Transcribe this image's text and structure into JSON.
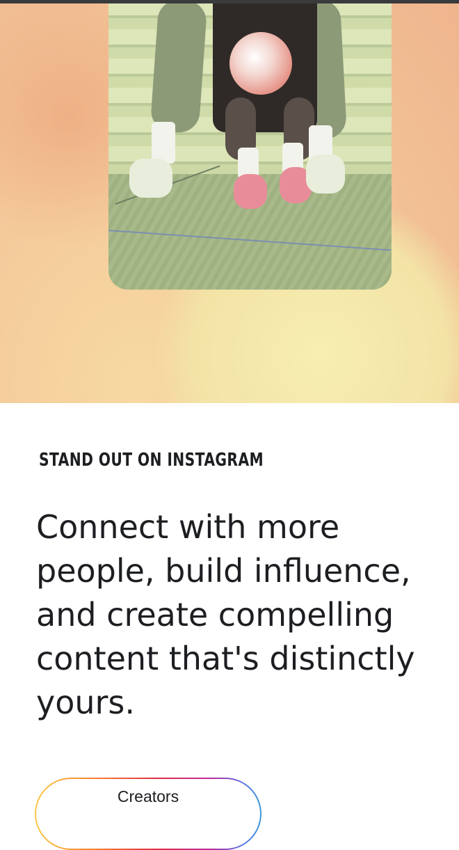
{
  "hero": {
    "image_alt": "Video of a person juggling a soccer ball on stairs",
    "background_colors": [
      "#f4c89a",
      "#f7eeb0",
      "#efb58e"
    ]
  },
  "section": {
    "eyebrow": "STAND OUT ON INSTAGRAM",
    "headline": "Connect with more people, build influence, and create compelling content that's distinctly yours."
  },
  "cta": {
    "label": "Creators",
    "gradient_colors": [
      "#fcc944",
      "#f57c2e",
      "#e12a48",
      "#bb2a9c",
      "#5a73e8",
      "#3b9ad9"
    ]
  }
}
